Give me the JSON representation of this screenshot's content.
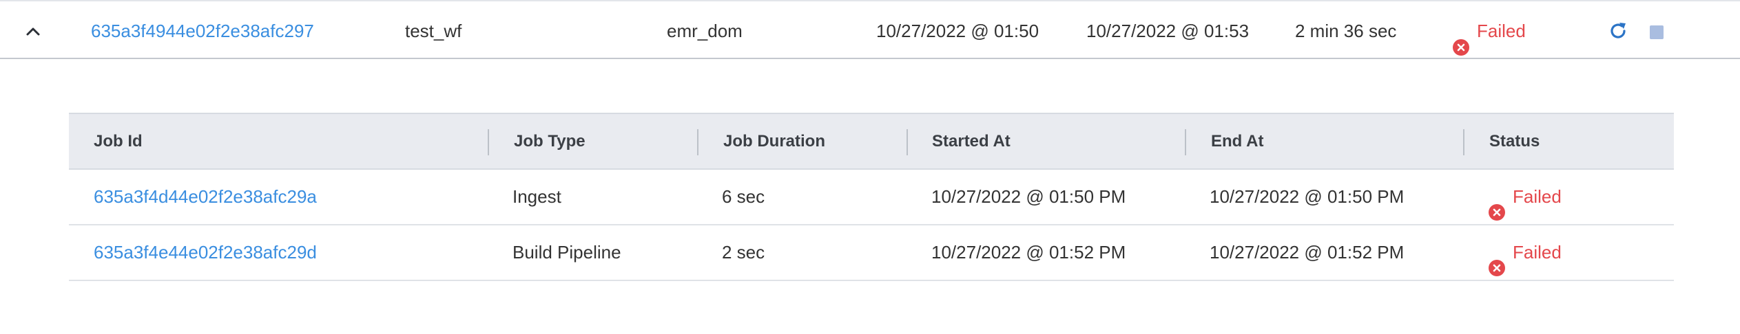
{
  "workflow_run": {
    "id": "635a3f4944e02f2e38afc297",
    "workflow_name": "test_wf",
    "domain": "emr_dom",
    "started_at": "10/27/2022 @ 01:50",
    "ended_at": "10/27/2022 @ 01:53",
    "duration": "2 min 36 sec",
    "status": "Failed",
    "expanded": true
  },
  "jobs_table": {
    "columns": [
      "Job Id",
      "Job Type",
      "Job Duration",
      "Started At",
      "End At",
      "Status"
    ],
    "rows": [
      {
        "job_id": "635a3f4d44e02f2e38afc29a",
        "job_type": "Ingest",
        "duration": "6 sec",
        "started_at": "10/27/2022 @ 01:50 PM",
        "end_at": "10/27/2022 @ 01:50 PM",
        "status": "Failed"
      },
      {
        "job_id": "635a3f4e44e02f2e38afc29d",
        "job_type": "Build Pipeline",
        "duration": "2 sec",
        "started_at": "10/27/2022 @ 01:52 PM",
        "end_at": "10/27/2022 @ 01:52 PM",
        "status": "Failed"
      }
    ]
  },
  "icons": {
    "collapse": "chevron-up-icon",
    "status_failed": "x-circle-icon",
    "rerun": "refresh-icon",
    "stop": "stop-icon"
  },
  "colors": {
    "link": "#3a8ee0",
    "failed": "#e4474b",
    "header_bg": "#e9ebf0",
    "stop_icon": "#a9bde0"
  }
}
